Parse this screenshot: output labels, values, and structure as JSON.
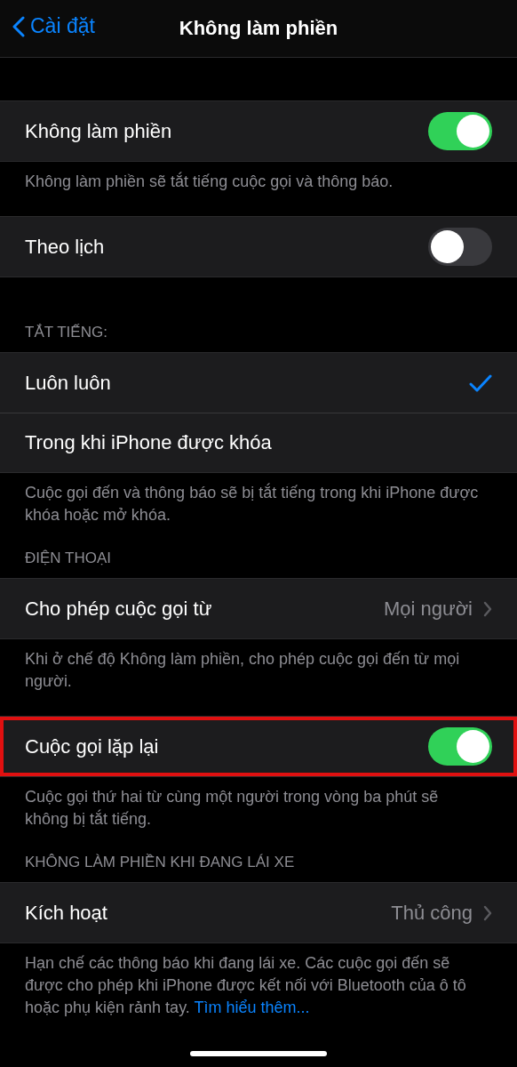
{
  "nav": {
    "back": "Cài đặt",
    "title": "Không làm phiền"
  },
  "sections": [
    {
      "rows": [
        {
          "kind": "toggle",
          "label": "Không làm phiền",
          "on": true,
          "highlighted": false
        }
      ],
      "footer": "Không làm phiền sẽ tắt tiếng cuộc gọi và thông báo."
    },
    {
      "rows": [
        {
          "kind": "toggle",
          "label": "Theo lịch",
          "on": false,
          "highlighted": false
        }
      ]
    },
    {
      "header": "TẮT TIẾNG:",
      "rows": [
        {
          "kind": "check",
          "label": "Luôn luôn",
          "selected": true,
          "highlighted": false
        },
        {
          "kind": "check",
          "label": "Trong khi iPhone được khóa",
          "selected": false,
          "highlighted": false
        }
      ],
      "footer": "Cuộc gọi đến và thông báo sẽ bị tắt tiếng trong khi iPhone được khóa hoặc mở khóa."
    },
    {
      "header": "ĐIỆN THOẠI",
      "rows": [
        {
          "kind": "link",
          "label": "Cho phép cuộc gọi từ",
          "value": "Mọi người",
          "highlighted": false
        }
      ],
      "footer": "Khi ở chế độ Không làm phiền, cho phép cuộc gọi đến từ mọi người."
    },
    {
      "rows": [
        {
          "kind": "toggle",
          "label": "Cuộc gọi lặp lại",
          "on": true,
          "highlighted": true
        }
      ],
      "footer": "Cuộc gọi thứ hai từ cùng một người trong vòng ba phút sẽ không bị tắt tiếng."
    },
    {
      "header": "KHÔNG LÀM PHIỀN KHI ĐANG LÁI XE",
      "rows": [
        {
          "kind": "link",
          "label": "Kích hoạt",
          "value": "Thủ công",
          "highlighted": false
        }
      ],
      "footer": "Hạn chế các thông báo khi đang lái xe. Các cuộc gọi đến sẽ được cho phép khi iPhone được kết nối với Bluetooth của ô tô hoặc phụ kiện rảnh tay.",
      "footer_link": "Tìm hiểu thêm..."
    }
  ]
}
